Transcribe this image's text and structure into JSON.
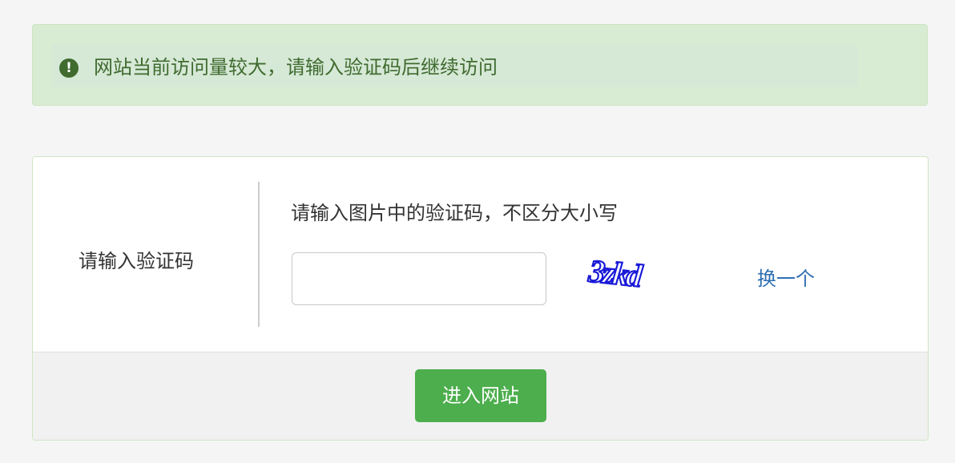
{
  "alert": {
    "icon": "exclamation-circle-icon",
    "message": "网站当前访问量较大，请输入验证码后继续访问"
  },
  "form": {
    "label": "请输入验证码",
    "hint": "请输入图片中的验证码，不区分大小写",
    "input": {
      "value": "",
      "placeholder": ""
    },
    "captcha_text": "3zkd",
    "refresh_label": "换一个",
    "submit_label": "进入网站"
  },
  "colors": {
    "alert_bg": "#d8ebd3",
    "alert_text": "#3f6b2f",
    "link": "#2f6fb1",
    "submit_bg": "#4cae4c",
    "captcha_ink": "#1a1ad8"
  }
}
